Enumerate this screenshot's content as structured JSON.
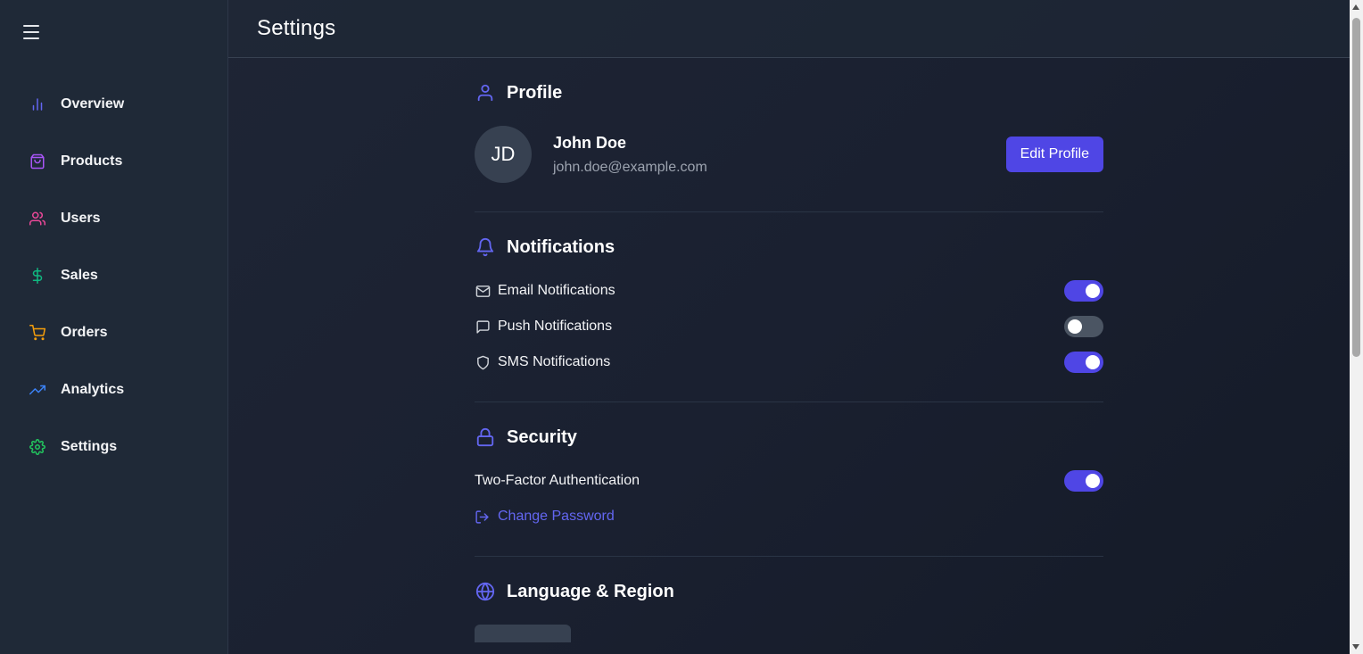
{
  "header": {
    "title": "Settings"
  },
  "sidebar": {
    "items": [
      {
        "label": "Overview",
        "icon": "bar-chart-icon",
        "color": "#6366f1"
      },
      {
        "label": "Products",
        "icon": "shopping-bag-icon",
        "color": "#a855f7"
      },
      {
        "label": "Users",
        "icon": "users-icon",
        "color": "#ec4899"
      },
      {
        "label": "Sales",
        "icon": "dollar-icon",
        "color": "#10b981"
      },
      {
        "label": "Orders",
        "icon": "shopping-cart-icon",
        "color": "#f59e0b"
      },
      {
        "label": "Analytics",
        "icon": "trending-up-icon",
        "color": "#3b82f6"
      },
      {
        "label": "Settings",
        "icon": "gear-icon",
        "color": "#22c55e"
      }
    ]
  },
  "profile": {
    "title": "Profile",
    "initials": "JD",
    "name": "John Doe",
    "email": "john.doe@example.com",
    "edit_label": "Edit Profile"
  },
  "notifications": {
    "title": "Notifications",
    "items": [
      {
        "label": "Email Notifications",
        "icon": "mail-icon",
        "enabled": true
      },
      {
        "label": "Push Notifications",
        "icon": "message-icon",
        "enabled": false
      },
      {
        "label": "SMS Notifications",
        "icon": "shield-icon",
        "enabled": true
      }
    ]
  },
  "security": {
    "title": "Security",
    "two_factor_label": "Two-Factor Authentication",
    "two_factor_enabled": true,
    "change_password_label": "Change Password"
  },
  "language": {
    "title": "Language & Region"
  },
  "colors": {
    "accent": "#4f46e5",
    "link": "#6366f1",
    "bg": "#111827",
    "sidebar": "#1f2937"
  }
}
